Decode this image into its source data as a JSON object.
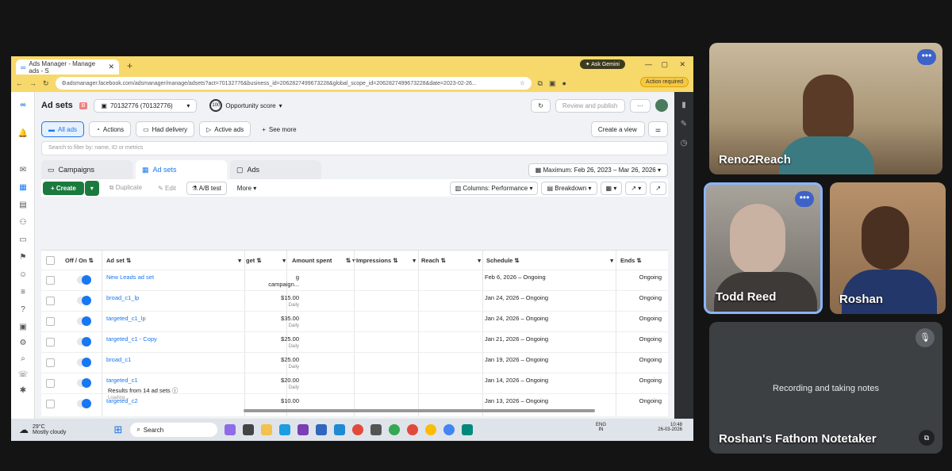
{
  "browser": {
    "tab_title": "Ads Manager - Manage ads - S",
    "new_tab": "+",
    "ask_gemini": "Ask Gemini",
    "url": "adsmanager.facebook.com/adsmanager/manage/adsets?act=70132776&business_id=2062827499673228&global_scope_id=2062827499673228&date=2023-02-26...",
    "action_required": "Action required"
  },
  "ads": {
    "page_title": "Ad sets",
    "account_badge": "B",
    "account": "70132776 (70132776)",
    "score_value": "100",
    "opportunity_score": "Opportunity score",
    "review_publish": "Review and publish",
    "more_dots": "···",
    "filters": [
      "All ads",
      "Actions",
      "Had delivery",
      "Active ads"
    ],
    "see_more": "See more",
    "create_view": "Create a view",
    "search_placeholder": "Search to filter by: name, ID or metrics",
    "level_tabs": [
      "Campaigns",
      "Ad sets",
      "Ads"
    ],
    "date_range": "Maximum: Feb 26, 2023 – Mar 26, 2026",
    "toolbar": {
      "create": "+ Create",
      "duplicate": "Duplicate",
      "edit": "Edit",
      "ab_test": "A/B test",
      "more": "More",
      "columns": "Columns: Performance",
      "breakdown": "Breakdown"
    },
    "columns": [
      "Off / On",
      "Ad set",
      "get",
      "Amount spent",
      "Impressions",
      "Reach",
      "Schedule",
      "Ends"
    ],
    "rows": [
      {
        "name": "New Leads ad set",
        "budget": "g campaign...",
        "daily": "",
        "schedule": "Feb 6, 2026 – Ongoing",
        "ends": "Ongoing"
      },
      {
        "name": "broad_c1_lp",
        "budget": "$15.00",
        "daily": "Daily",
        "schedule": "Jan 24, 2026 – Ongoing",
        "ends": "Ongoing"
      },
      {
        "name": "targeted_c1_lp",
        "budget": "$35.00",
        "daily": "Daily",
        "schedule": "Jan 24, 2026 – Ongoing",
        "ends": "Ongoing"
      },
      {
        "name": "targeted_c1 - Copy",
        "budget": "$25.00",
        "daily": "Daily",
        "schedule": "Jan 21, 2026 – Ongoing",
        "ends": "Ongoing"
      },
      {
        "name": "broad_c1",
        "budget": "$25.00",
        "daily": "Daily",
        "schedule": "Jan 19, 2026 – Ongoing",
        "ends": "Ongoing"
      },
      {
        "name": "targeted_c1",
        "budget": "$20.00",
        "daily": "Daily",
        "schedule": "Jan 14, 2026 – Ongoing",
        "ends": "Ongoing"
      },
      {
        "name": "targeted_c2",
        "budget": "$10.00",
        "daily": "",
        "schedule": "Jan 13, 2026 – Ongoing",
        "ends": "Ongoing"
      }
    ],
    "results": "Results from 14 ad sets",
    "loading": "Loading..."
  },
  "taskbar": {
    "temp": "29°C",
    "weather": "Mostly cloudy",
    "search": "Search",
    "lang": "ENG",
    "lang_region": "IN",
    "time": "10:48",
    "date": "26-03-2026"
  },
  "meeting": {
    "participants": [
      "Reno2Reach",
      "Todd Reed",
      "Roshan"
    ],
    "notetaker_status": "Recording and taking notes",
    "notetaker_name": "Roshan's Fathom Notetaker"
  },
  "colors": {
    "accent": "#1877f2",
    "create_green": "#1b7a3e",
    "browser_frame": "#f7d86a",
    "active_speaker": "#8ab4f8"
  }
}
